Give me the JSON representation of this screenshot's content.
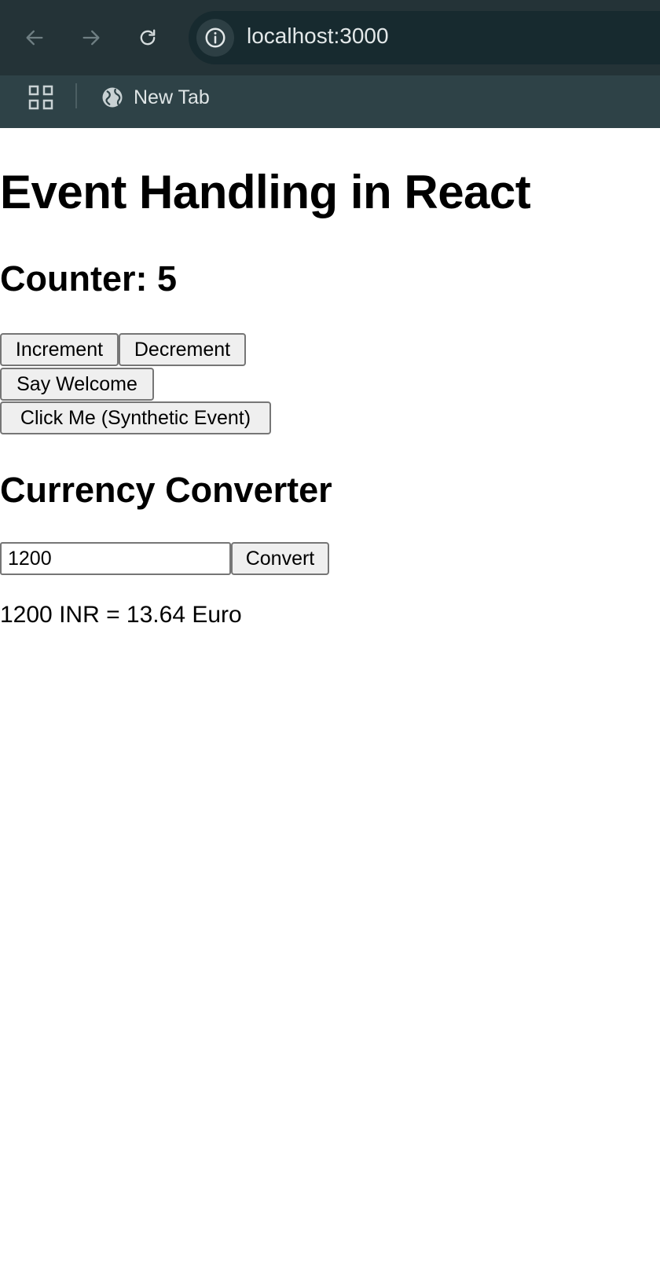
{
  "browser": {
    "url": "localhost:3000",
    "bookmarks": [
      {
        "label": "New Tab",
        "icon": "globe-icon"
      }
    ],
    "colors": {
      "toolbar": "#243337",
      "bookmarks_bar": "#2e4247",
      "omnibox": "#172a2f"
    }
  },
  "page": {
    "title": "Event Handling in React",
    "counter": {
      "heading": "Counter: 5",
      "increment_label": "Increment",
      "decrement_label": "Decrement",
      "welcome_label": "Say Welcome",
      "synthetic_label": "Click Me (Synthetic Event)"
    },
    "converter": {
      "heading": "Currency Converter",
      "amount_value": "1200",
      "convert_label": "Convert",
      "result": "1200 INR = 13.64 Euro"
    }
  }
}
